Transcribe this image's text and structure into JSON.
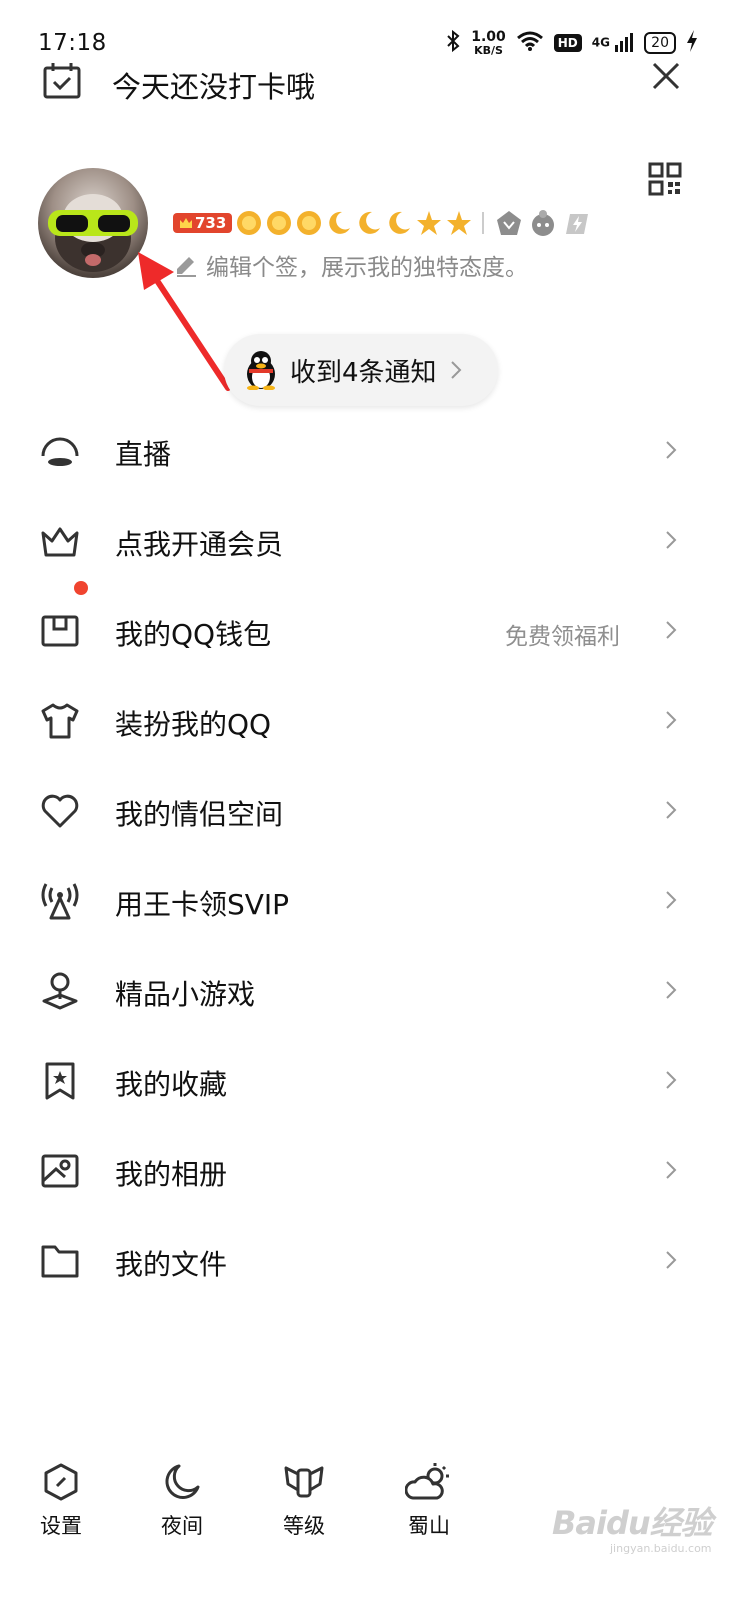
{
  "status_bar": {
    "time": "17:18",
    "net_speed_value": "1.00",
    "net_speed_unit": "KB/S",
    "hd_label": "HD",
    "network_type": "4G",
    "battery": "20"
  },
  "header": {
    "checkin_text": "今天还没打卡哦"
  },
  "profile": {
    "level": "733",
    "signature_placeholder": "编辑个签，展示我的独特态度。"
  },
  "notification": {
    "text": "收到4条通知"
  },
  "menu": {
    "items": [
      {
        "label": "直播",
        "icon": "live-icon"
      },
      {
        "label": "点我开通会员",
        "icon": "crown-icon"
      },
      {
        "label": "我的QQ钱包",
        "icon": "wallet-icon",
        "hint": "免费领福利",
        "badge": true
      },
      {
        "label": "装扮我的QQ",
        "icon": "tshirt-icon"
      },
      {
        "label": "我的情侣空间",
        "icon": "heart-icon"
      },
      {
        "label": "用王卡领SVIP",
        "icon": "antenna-icon"
      },
      {
        "label": "精品小游戏",
        "icon": "game-icon"
      },
      {
        "label": "我的收藏",
        "icon": "bookmark-star-icon"
      },
      {
        "label": "我的相册",
        "icon": "album-icon"
      },
      {
        "label": "我的文件",
        "icon": "folder-icon"
      }
    ]
  },
  "bottom_bar": {
    "items": [
      {
        "label": "设置",
        "icon": "settings-icon"
      },
      {
        "label": "夜间",
        "icon": "moon-icon"
      },
      {
        "label": "等级",
        "icon": "level-wings-icon"
      },
      {
        "label": "蜀山",
        "icon": "weather-icon"
      }
    ]
  },
  "watermark": {
    "text": "Baidu经验",
    "sub": "jingyan.baidu.com"
  },
  "colors": {
    "accent_red": "#f0442f",
    "text_primary": "#111111",
    "text_secondary": "#8a8a8a",
    "pill_bg": "#f3f3f3"
  }
}
